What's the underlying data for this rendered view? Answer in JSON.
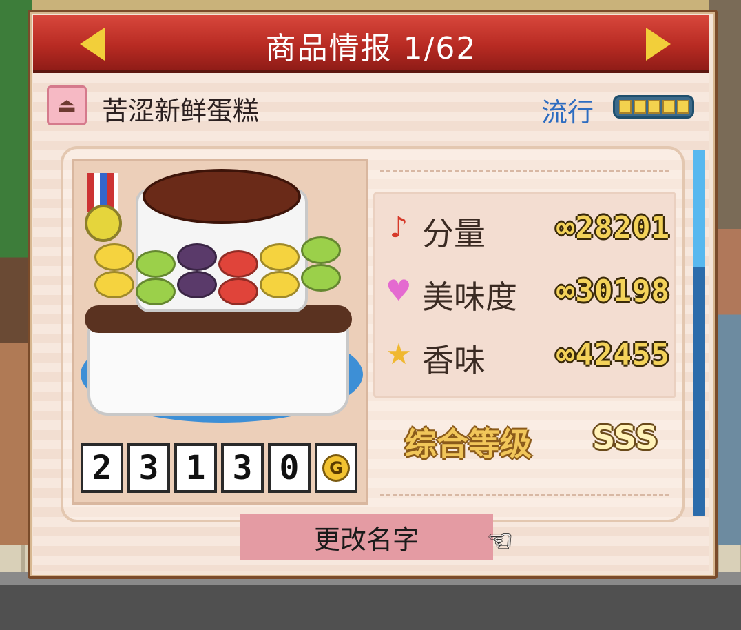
{
  "header": {
    "title": "商品情报 1/62",
    "prev_icon": "left-arrow-icon",
    "next_icon": "right-arrow-icon"
  },
  "product": {
    "icon": "cake-icon",
    "name": "苦涩新鲜蛋糕",
    "trend_label": "流行",
    "trend_level": 5,
    "trend_max": 5
  },
  "price": {
    "digits": [
      "2",
      "3",
      "1",
      "3",
      "0"
    ],
    "currency_symbol": "G"
  },
  "stats": [
    {
      "icon": "music-note-icon",
      "label": "分量",
      "value": "∞28201"
    },
    {
      "icon": "heart-icon",
      "label": "美味度",
      "value": "∞30198"
    },
    {
      "icon": "star-icon",
      "label": "香味",
      "value": "∞42455"
    }
  ],
  "rank": {
    "label": "综合等级",
    "value": "SSS"
  },
  "actions": {
    "rename_label": "更改名字",
    "pointer_icon": "pointing-hand-icon"
  },
  "colors": {
    "header_red": "#b82b23",
    "accent_yellow": "#f2cf3a",
    "trend_blue": "#2d6cc0",
    "button_pink": "#e49ba3"
  }
}
